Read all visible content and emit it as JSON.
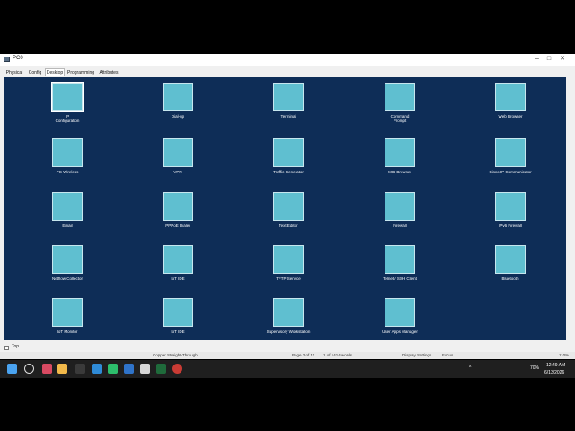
{
  "window": {
    "title": "PC0"
  },
  "tabs": [
    {
      "label": "Physical"
    },
    {
      "label": "Config"
    },
    {
      "label": "Desktop"
    },
    {
      "label": "Programming"
    },
    {
      "label": "Attributes"
    }
  ],
  "apps": [
    {
      "label": "IP\nConfiguration",
      "icon": "ip-configuration-icon"
    },
    {
      "label": "Dial-up",
      "icon": "dial-up-icon"
    },
    {
      "label": "Terminal",
      "icon": "terminal-icon"
    },
    {
      "label": "Command\nPrompt",
      "icon": "command-prompt-icon"
    },
    {
      "label": "Web Browser",
      "icon": "web-browser-icon"
    },
    {
      "label": "PC Wireless",
      "icon": "pc-wireless-icon"
    },
    {
      "label": "VPN",
      "icon": "vpn-icon"
    },
    {
      "label": "Traffic Generator",
      "icon": "traffic-generator-icon"
    },
    {
      "label": "MIB Browser",
      "icon": "mib-browser-icon"
    },
    {
      "label": "Cisco IP Communicator",
      "icon": "ip-communicator-icon"
    },
    {
      "label": "Email",
      "icon": "email-icon"
    },
    {
      "label": "PPPoE Dialer",
      "icon": "pppoe-dialer-icon"
    },
    {
      "label": "Text Editor",
      "icon": "text-editor-icon"
    },
    {
      "label": "Firewall",
      "icon": "firewall-icon"
    },
    {
      "label": "IPv6 Firewall",
      "icon": "ipv6-firewall-icon"
    },
    {
      "label": "Netflow Collector",
      "icon": "netflow-collector-icon"
    },
    {
      "label": "IoT IDE",
      "icon": "iot-ide-sdk-icon"
    },
    {
      "label": "TFTP Service",
      "icon": "tftp-folder-icon"
    },
    {
      "label": "Telnet / SSH Client",
      "icon": "telnet-ssh-icon"
    },
    {
      "label": "Bluetooth",
      "icon": "bluetooth-icon"
    },
    {
      "label": "IoT Monitor",
      "icon": "iot-monitor-icon"
    },
    {
      "label": "IoT IDE",
      "icon": "iot-ide-icon"
    },
    {
      "label": "Supervisory Workstation",
      "icon": "supervisory-workstation-icon"
    },
    {
      "label": "User Apps Manager",
      "icon": "user-apps-manager-icon"
    }
  ],
  "status": {
    "top_label": "Top"
  },
  "docbar": {
    "cable": "Copper Straight-Through",
    "page": "Page 2 of 11",
    "words": "1 of 1414 words",
    "display": "Display Settings",
    "focus": "Focus",
    "zoom": "110%"
  },
  "taskbar": {
    "time": "12:49 AM",
    "date": "6/13/2026",
    "battery": "70%"
  },
  "colors": {
    "desktop": "#0e2d57",
    "tile": "#5fbfd0"
  }
}
